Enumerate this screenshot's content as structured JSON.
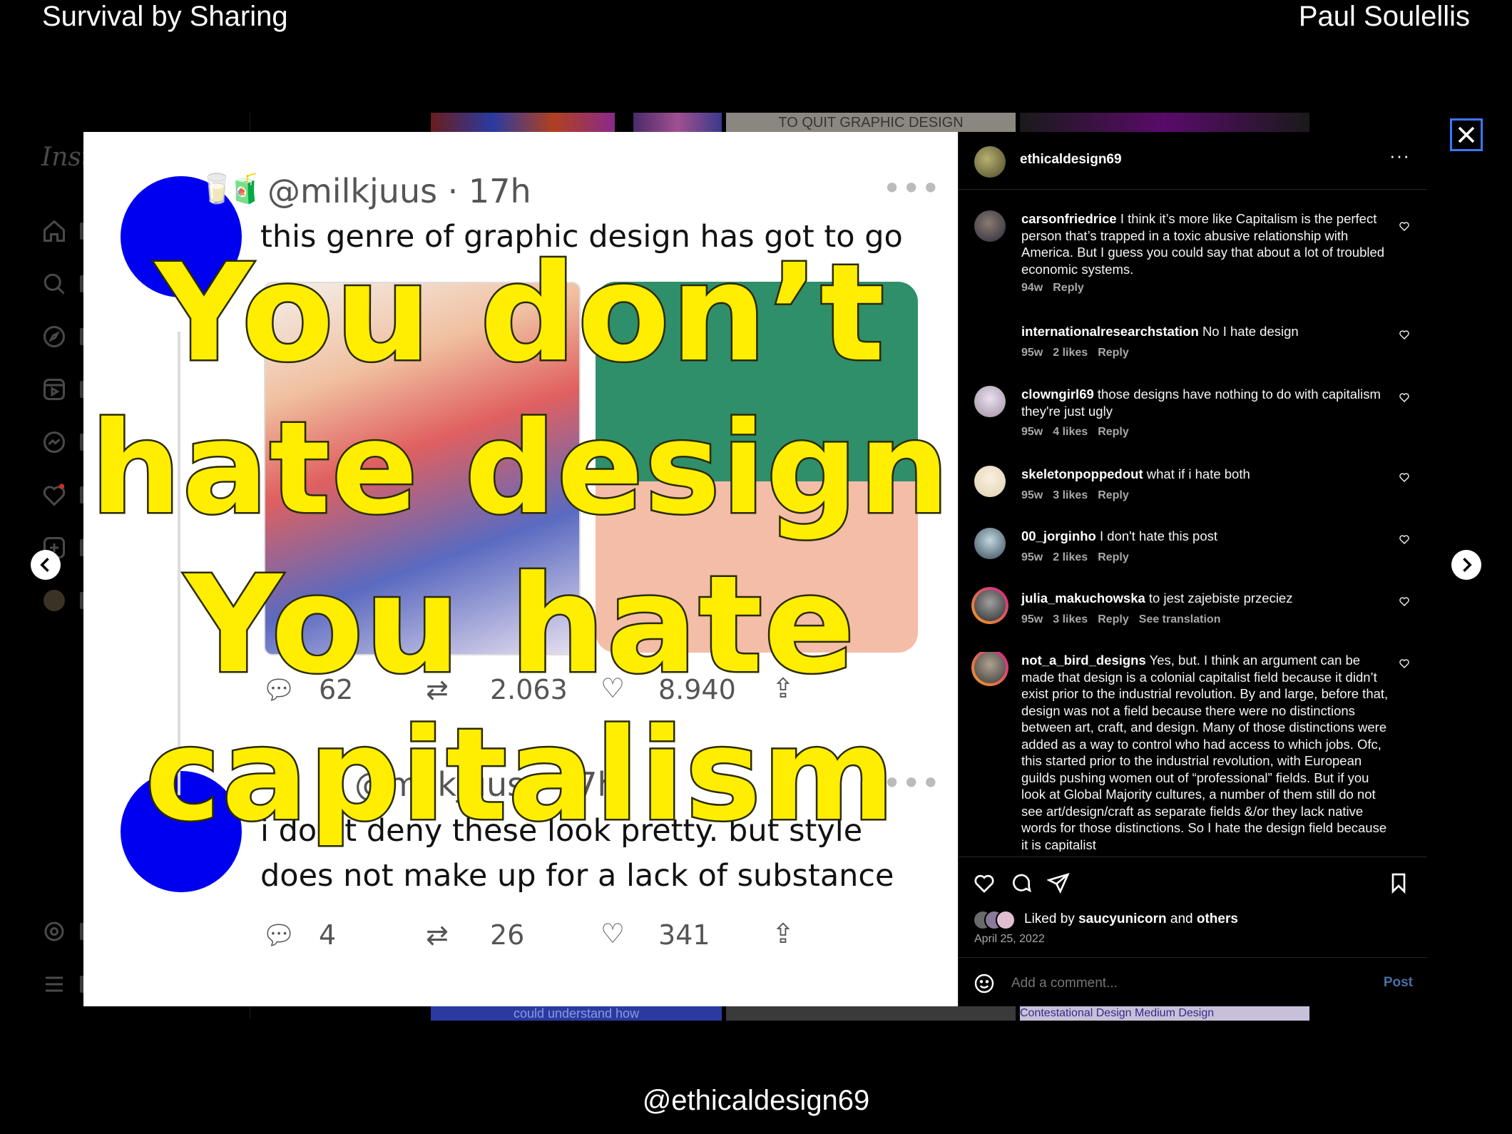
{
  "slide": {
    "title_left": "Survival by Sharing",
    "title_right": "Paul Soulellis",
    "footer": "@ethicaldesign69"
  },
  "background": {
    "logo_text": "Insta",
    "grid_text_top": "TO QUIT GRAPHIC DESIGN",
    "grid_text_bottom": "could understand how",
    "grid_text_bottom_right": "Contestational Design Medium Design"
  },
  "post": {
    "tweet1": {
      "handle": "@milkjuus · 17h",
      "text": "this genre of graphic design has got to go",
      "replies": "62",
      "retweets": "2.063",
      "likes": "8.940"
    },
    "tweet2": {
      "handle": "@milkjuus · 17h",
      "text_line1": "i don't deny these look pretty. but style",
      "text_line2": "does not make up for a lack of substance",
      "replies": "4",
      "retweets": "26",
      "likes": "341"
    },
    "overlay": {
      "line1": "You don’t",
      "line2": "hate design",
      "line3": "You hate",
      "line4": "capitalism"
    }
  },
  "panel": {
    "author": "ethicaldesign69",
    "more_icon": "more-horizontal-icon",
    "comments": [
      {
        "user": "carsonfriedrice",
        "text": "I think it’s more like Capitalism is the perfect person that’s trapped in a toxic abusive relationship with America. But I guess you could say that about a lot of troubled economic systems.",
        "time": "94w",
        "likes": "",
        "reply": "Reply",
        "translate": ""
      },
      {
        "user": "internationalresearchstation",
        "text": "No I hate design",
        "time": "95w",
        "likes": "2 likes",
        "reply": "Reply",
        "translate": ""
      },
      {
        "user": "clowngirl69",
        "text": "those designs have nothing to do with capitalism they're just ugly",
        "time": "95w",
        "likes": "4 likes",
        "reply": "Reply",
        "translate": ""
      },
      {
        "user": "skeletonpoppedout",
        "text": "what if i hate both",
        "time": "95w",
        "likes": "3 likes",
        "reply": "Reply",
        "translate": ""
      },
      {
        "user": "00_jorginho",
        "text": "I don't hate this post",
        "time": "95w",
        "likes": "2 likes",
        "reply": "Reply",
        "translate": ""
      },
      {
        "user": "julia_makuchowska",
        "text": "to jest zajebiste przeciez",
        "time": "95w",
        "likes": "3 likes",
        "reply": "Reply",
        "translate": "See translation"
      },
      {
        "user": "not_a_bird_designs",
        "text": "Yes, but. I think an argument can be made that design is a colonial capitalist field because it didn’t exist prior to the industrial revolution. By and large, before that, design was not a field because there were no distinctions between art, craft, and design. Many of those distinctions were added as a way to control who had access to which jobs. Ofc, this started prior to the industrial revolution, with European guilds pushing women out of “professional” fields. But if you look at Global Majority cultures, a number of them still do not see art/design/craft as separate fields &/or they lack native words for those distinctions. So I hate the design field because it is capitalist",
        "time": "",
        "likes": "",
        "reply": "",
        "translate": ""
      }
    ],
    "liked_by_prefix": "Liked by",
    "liked_by_user": "saucyunicorn",
    "liked_by_and": "and",
    "liked_by_others": "others",
    "date": "April 25, 2022",
    "comment_placeholder": "Add a comment...",
    "post_button": "Post"
  },
  "colors": {
    "overlay_yellow": "#ffee00",
    "dot_blue": "#0000f0",
    "post_link_blue": "#4a6fa5",
    "close_outline": "#3a78ff"
  }
}
